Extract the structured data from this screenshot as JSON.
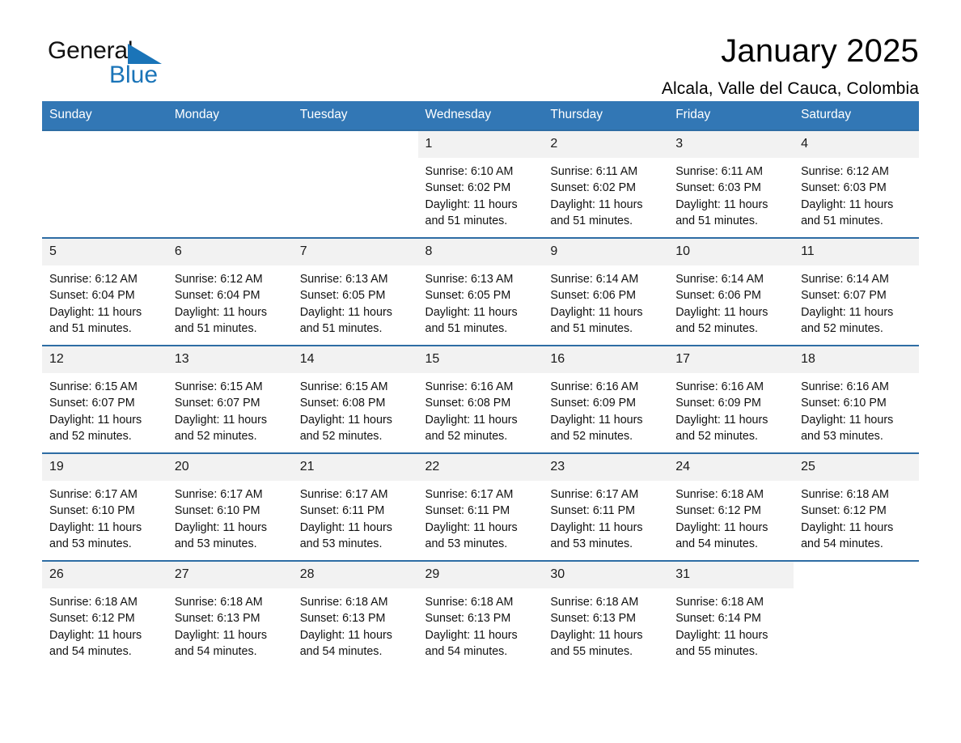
{
  "brand": {
    "name_part1": "General",
    "name_part2": "Blue",
    "logo_icon": "triangle-logo-mark",
    "accent_color": "#1a74b8"
  },
  "header": {
    "title": "January 2025",
    "subtitle": "Alcala, Valle del Cauca, Colombia"
  },
  "calendar": {
    "header_bg": "#3277b5",
    "daynum_bg": "#f2f2f2",
    "row_divider": "#2e6da4",
    "weekday_headers": [
      "Sunday",
      "Monday",
      "Tuesday",
      "Wednesday",
      "Thursday",
      "Friday",
      "Saturday"
    ],
    "weeks": [
      [
        {
          "day": "",
          "sunrise": "",
          "sunset": "",
          "daylight1": "",
          "daylight2": "",
          "empty": true
        },
        {
          "day": "",
          "sunrise": "",
          "sunset": "",
          "daylight1": "",
          "daylight2": "",
          "empty": true
        },
        {
          "day": "",
          "sunrise": "",
          "sunset": "",
          "daylight1": "",
          "daylight2": "",
          "empty": true
        },
        {
          "day": "1",
          "sunrise": "Sunrise: 6:10 AM",
          "sunset": "Sunset: 6:02 PM",
          "daylight1": "Daylight: 11 hours",
          "daylight2": "and 51 minutes."
        },
        {
          "day": "2",
          "sunrise": "Sunrise: 6:11 AM",
          "sunset": "Sunset: 6:02 PM",
          "daylight1": "Daylight: 11 hours",
          "daylight2": "and 51 minutes."
        },
        {
          "day": "3",
          "sunrise": "Sunrise: 6:11 AM",
          "sunset": "Sunset: 6:03 PM",
          "daylight1": "Daylight: 11 hours",
          "daylight2": "and 51 minutes."
        },
        {
          "day": "4",
          "sunrise": "Sunrise: 6:12 AM",
          "sunset": "Sunset: 6:03 PM",
          "daylight1": "Daylight: 11 hours",
          "daylight2": "and 51 minutes."
        }
      ],
      [
        {
          "day": "5",
          "sunrise": "Sunrise: 6:12 AM",
          "sunset": "Sunset: 6:04 PM",
          "daylight1": "Daylight: 11 hours",
          "daylight2": "and 51 minutes."
        },
        {
          "day": "6",
          "sunrise": "Sunrise: 6:12 AM",
          "sunset": "Sunset: 6:04 PM",
          "daylight1": "Daylight: 11 hours",
          "daylight2": "and 51 minutes."
        },
        {
          "day": "7",
          "sunrise": "Sunrise: 6:13 AM",
          "sunset": "Sunset: 6:05 PM",
          "daylight1": "Daylight: 11 hours",
          "daylight2": "and 51 minutes."
        },
        {
          "day": "8",
          "sunrise": "Sunrise: 6:13 AM",
          "sunset": "Sunset: 6:05 PM",
          "daylight1": "Daylight: 11 hours",
          "daylight2": "and 51 minutes."
        },
        {
          "day": "9",
          "sunrise": "Sunrise: 6:14 AM",
          "sunset": "Sunset: 6:06 PM",
          "daylight1": "Daylight: 11 hours",
          "daylight2": "and 51 minutes."
        },
        {
          "day": "10",
          "sunrise": "Sunrise: 6:14 AM",
          "sunset": "Sunset: 6:06 PM",
          "daylight1": "Daylight: 11 hours",
          "daylight2": "and 52 minutes."
        },
        {
          "day": "11",
          "sunrise": "Sunrise: 6:14 AM",
          "sunset": "Sunset: 6:07 PM",
          "daylight1": "Daylight: 11 hours",
          "daylight2": "and 52 minutes."
        }
      ],
      [
        {
          "day": "12",
          "sunrise": "Sunrise: 6:15 AM",
          "sunset": "Sunset: 6:07 PM",
          "daylight1": "Daylight: 11 hours",
          "daylight2": "and 52 minutes."
        },
        {
          "day": "13",
          "sunrise": "Sunrise: 6:15 AM",
          "sunset": "Sunset: 6:07 PM",
          "daylight1": "Daylight: 11 hours",
          "daylight2": "and 52 minutes."
        },
        {
          "day": "14",
          "sunrise": "Sunrise: 6:15 AM",
          "sunset": "Sunset: 6:08 PM",
          "daylight1": "Daylight: 11 hours",
          "daylight2": "and 52 minutes."
        },
        {
          "day": "15",
          "sunrise": "Sunrise: 6:16 AM",
          "sunset": "Sunset: 6:08 PM",
          "daylight1": "Daylight: 11 hours",
          "daylight2": "and 52 minutes."
        },
        {
          "day": "16",
          "sunrise": "Sunrise: 6:16 AM",
          "sunset": "Sunset: 6:09 PM",
          "daylight1": "Daylight: 11 hours",
          "daylight2": "and 52 minutes."
        },
        {
          "day": "17",
          "sunrise": "Sunrise: 6:16 AM",
          "sunset": "Sunset: 6:09 PM",
          "daylight1": "Daylight: 11 hours",
          "daylight2": "and 52 minutes."
        },
        {
          "day": "18",
          "sunrise": "Sunrise: 6:16 AM",
          "sunset": "Sunset: 6:10 PM",
          "daylight1": "Daylight: 11 hours",
          "daylight2": "and 53 minutes."
        }
      ],
      [
        {
          "day": "19",
          "sunrise": "Sunrise: 6:17 AM",
          "sunset": "Sunset: 6:10 PM",
          "daylight1": "Daylight: 11 hours",
          "daylight2": "and 53 minutes."
        },
        {
          "day": "20",
          "sunrise": "Sunrise: 6:17 AM",
          "sunset": "Sunset: 6:10 PM",
          "daylight1": "Daylight: 11 hours",
          "daylight2": "and 53 minutes."
        },
        {
          "day": "21",
          "sunrise": "Sunrise: 6:17 AM",
          "sunset": "Sunset: 6:11 PM",
          "daylight1": "Daylight: 11 hours",
          "daylight2": "and 53 minutes."
        },
        {
          "day": "22",
          "sunrise": "Sunrise: 6:17 AM",
          "sunset": "Sunset: 6:11 PM",
          "daylight1": "Daylight: 11 hours",
          "daylight2": "and 53 minutes."
        },
        {
          "day": "23",
          "sunrise": "Sunrise: 6:17 AM",
          "sunset": "Sunset: 6:11 PM",
          "daylight1": "Daylight: 11 hours",
          "daylight2": "and 53 minutes."
        },
        {
          "day": "24",
          "sunrise": "Sunrise: 6:18 AM",
          "sunset": "Sunset: 6:12 PM",
          "daylight1": "Daylight: 11 hours",
          "daylight2": "and 54 minutes."
        },
        {
          "day": "25",
          "sunrise": "Sunrise: 6:18 AM",
          "sunset": "Sunset: 6:12 PM",
          "daylight1": "Daylight: 11 hours",
          "daylight2": "and 54 minutes."
        }
      ],
      [
        {
          "day": "26",
          "sunrise": "Sunrise: 6:18 AM",
          "sunset": "Sunset: 6:12 PM",
          "daylight1": "Daylight: 11 hours",
          "daylight2": "and 54 minutes."
        },
        {
          "day": "27",
          "sunrise": "Sunrise: 6:18 AM",
          "sunset": "Sunset: 6:13 PM",
          "daylight1": "Daylight: 11 hours",
          "daylight2": "and 54 minutes."
        },
        {
          "day": "28",
          "sunrise": "Sunrise: 6:18 AM",
          "sunset": "Sunset: 6:13 PM",
          "daylight1": "Daylight: 11 hours",
          "daylight2": "and 54 minutes."
        },
        {
          "day": "29",
          "sunrise": "Sunrise: 6:18 AM",
          "sunset": "Sunset: 6:13 PM",
          "daylight1": "Daylight: 11 hours",
          "daylight2": "and 54 minutes."
        },
        {
          "day": "30",
          "sunrise": "Sunrise: 6:18 AM",
          "sunset": "Sunset: 6:13 PM",
          "daylight1": "Daylight: 11 hours",
          "daylight2": "and 55 minutes."
        },
        {
          "day": "31",
          "sunrise": "Sunrise: 6:18 AM",
          "sunset": "Sunset: 6:14 PM",
          "daylight1": "Daylight: 11 hours",
          "daylight2": "and 55 minutes."
        },
        {
          "day": "",
          "sunrise": "",
          "sunset": "",
          "daylight1": "",
          "daylight2": "",
          "empty": true
        }
      ]
    ]
  }
}
